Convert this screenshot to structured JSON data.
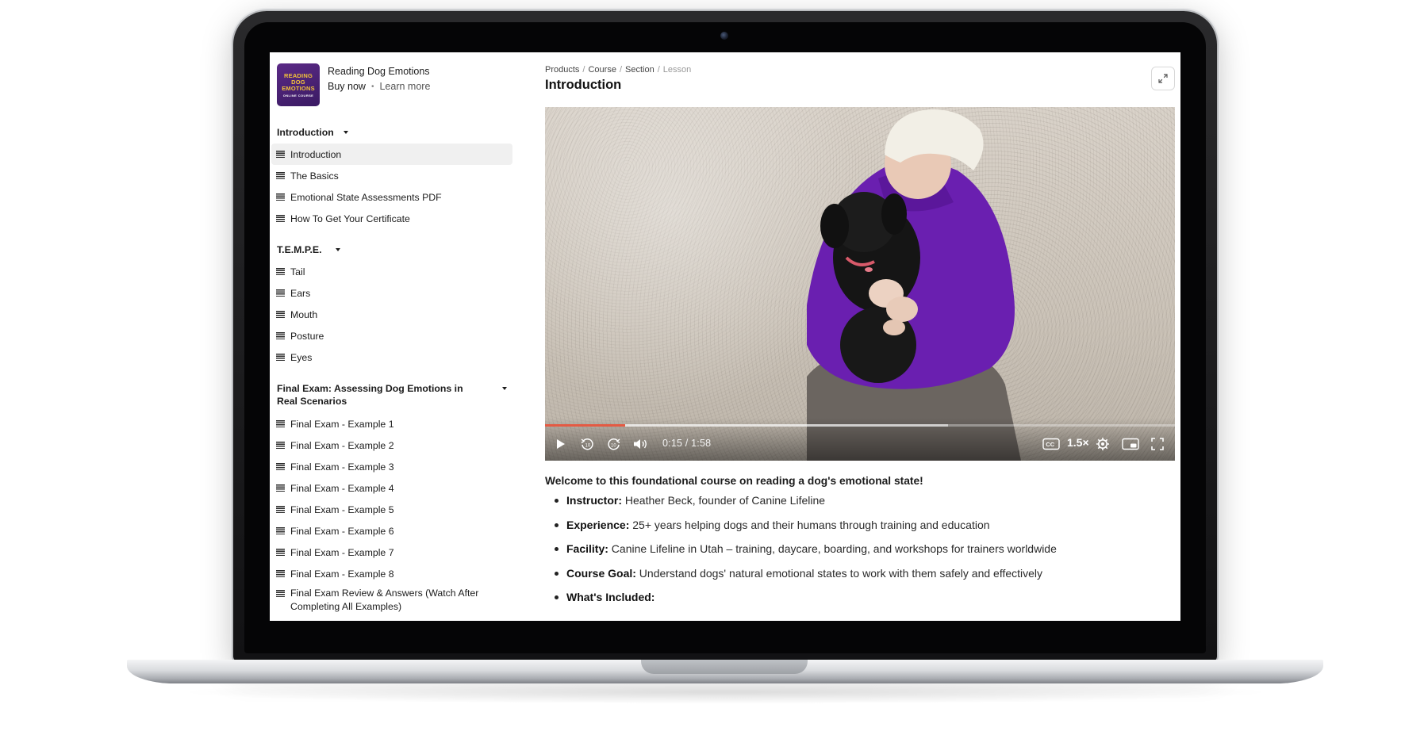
{
  "product": {
    "title": "Reading Dog Emotions",
    "buy_label": "Buy now",
    "learn_label": "Learn more",
    "thumb_lines": [
      "READING",
      "DOG",
      "EMOTIONS"
    ],
    "thumb_sub": "ONLINE COURSE"
  },
  "sections": [
    {
      "title": "Introduction",
      "lessons": [
        "Introduction",
        "The Basics",
        "Emotional State Assessments PDF",
        "How To Get Your Certificate"
      ],
      "active_index": 0
    },
    {
      "title": "T.E.M.P.E.",
      "lessons": [
        "Tail",
        "Ears",
        "Mouth",
        "Posture",
        "Eyes"
      ]
    },
    {
      "title": "Final Exam: Assessing Dog Emotions in Real Scenarios",
      "lessons": [
        "Final Exam - Example 1",
        "Final Exam - Example 2",
        "Final Exam - Example 3",
        "Final Exam - Example 4",
        "Final Exam - Example 5",
        "Final Exam - Example 6",
        "Final Exam - Example 7",
        "Final Exam - Example 8",
        "Final Exam Review & Answers (Watch After Completing All Examples)"
      ]
    }
  ],
  "breadcrumb": [
    "Products",
    "Course",
    "Section",
    "Lesson"
  ],
  "page_title": "Introduction",
  "video": {
    "time": "0:15 / 1:58",
    "speed": "1.5×",
    "progress": 0.127,
    "buffered": 0.64,
    "accent": "#e45a43"
  },
  "description": {
    "heading": "Welcome to this foundational course on reading a dog's emotional state!",
    "items": [
      {
        "label": "Instructor:",
        "text": " Heather Beck, founder of Canine Lifeline"
      },
      {
        "label": "Experience:",
        "text": " 25+ years helping dogs and their humans through training and education"
      },
      {
        "label": "Facility:",
        "text": " Canine Lifeline in Utah – training, daycare, boarding, and workshops for trainers worldwide"
      },
      {
        "label": "Course Goal:",
        "text": " Understand dogs' natural emotional states to work with them safely and effectively"
      },
      {
        "label": "What's Included:",
        "text": ""
      }
    ]
  },
  "icons": {
    "expand": "expand-icon",
    "play": "play-icon",
    "rewind": "rewind-10-icon",
    "forward": "forward-10-icon",
    "volume": "volume-icon",
    "captions": "cc-icon",
    "settings": "gear-icon",
    "pip": "picture-in-picture-icon",
    "fullscreen": "fullscreen-icon",
    "lesson": "lesson-text-icon"
  },
  "colors": {
    "thumb_bg": "#4a2274",
    "thumb_text": "#f3c23a",
    "active_row": "#f0f0f0"
  }
}
